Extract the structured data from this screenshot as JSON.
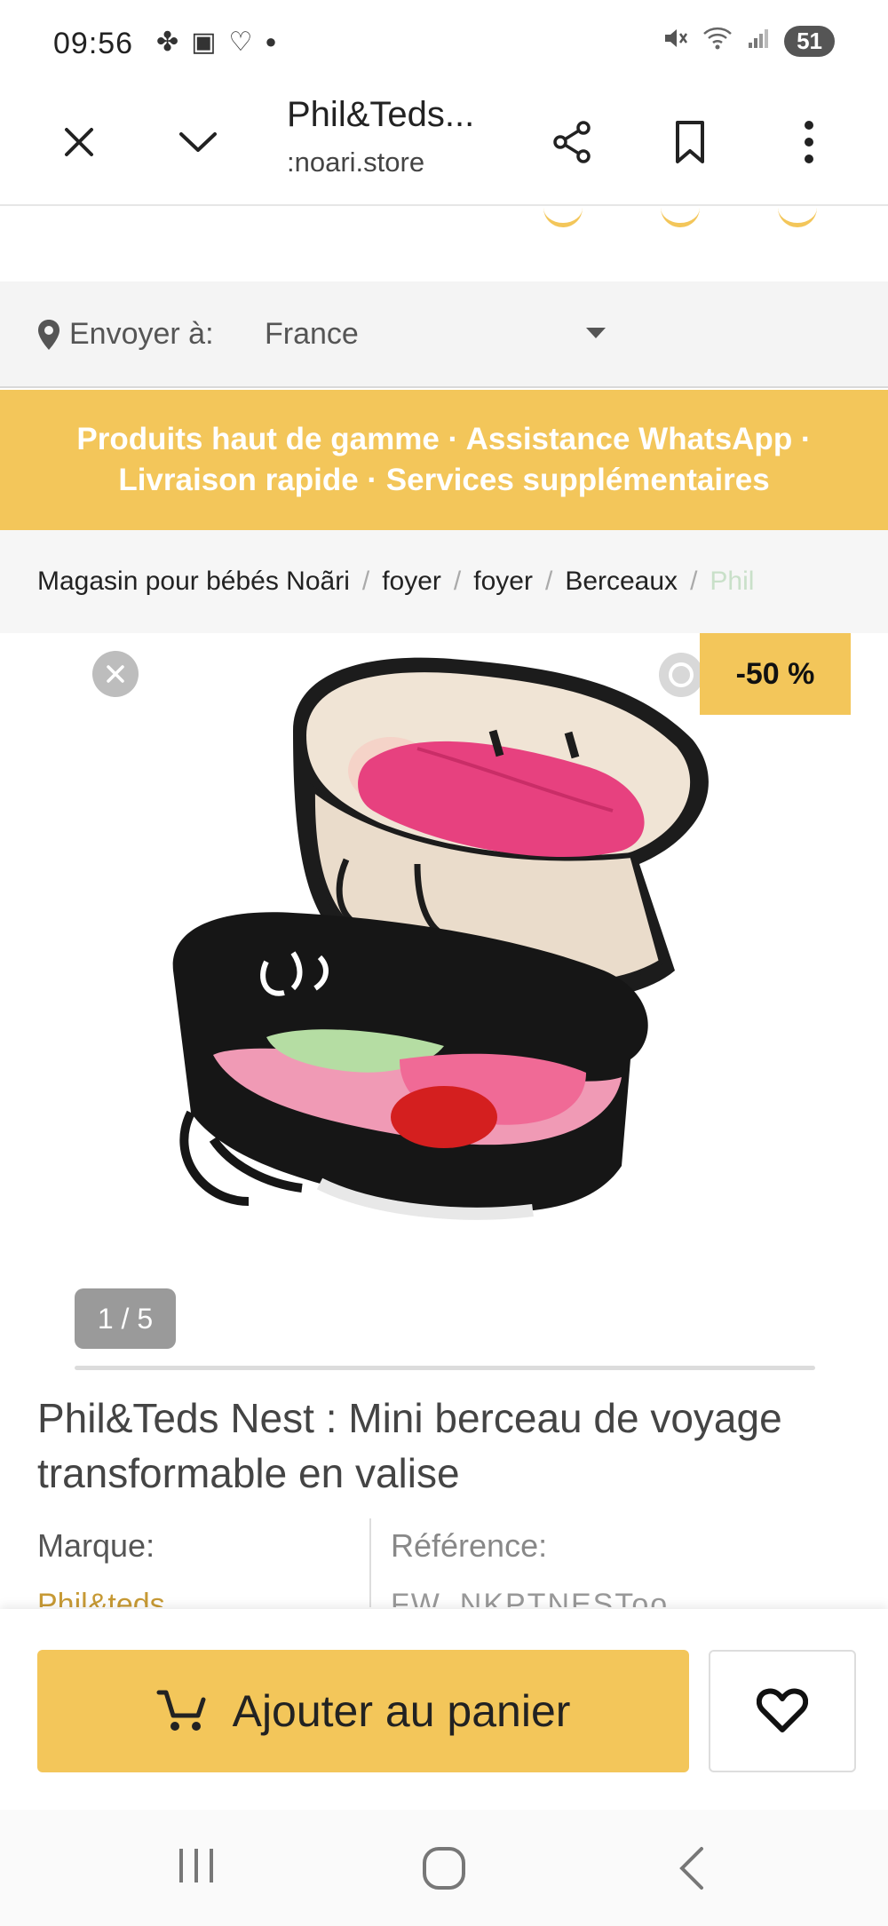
{
  "status_bar": {
    "time": "09:56",
    "left_icons": [
      "pinwheel-icon",
      "screen-record-icon",
      "heart-shield-icon",
      "dot-icon"
    ],
    "right_icons": [
      "mute-vibrate-icon",
      "wifi-icon",
      "signal-icon"
    ],
    "battery": "51"
  },
  "browser": {
    "title": "Phil&Teds...",
    "url": ":noari.store"
  },
  "ship": {
    "label": "Envoyer à:",
    "value": "France"
  },
  "banner": {
    "line1": "Produits haut de gamme · Assistance WhatsApp ·",
    "line2": "Livraison rapide · Services supplémentaires"
  },
  "breadcrumb": {
    "items": [
      "Magasin pour bébés Noãri",
      "foyer",
      "foyer",
      "Berceaux",
      "Phil"
    ],
    "separator": "/"
  },
  "gallery": {
    "discount": "-50 %",
    "counter": "1 / 5"
  },
  "product": {
    "title": "Phil&Teds Nest : Mini berceau de voyage transformable en valise",
    "brand_label": "Marque:",
    "brand_value": "Phil&teds",
    "ref_label": "Référence:",
    "ref_value": "FW_NKPTNESToo"
  },
  "actions": {
    "add_to_cart": "Ajouter au panier"
  },
  "colors": {
    "accent": "#f3c65a",
    "brand_link": "#c79a35"
  }
}
